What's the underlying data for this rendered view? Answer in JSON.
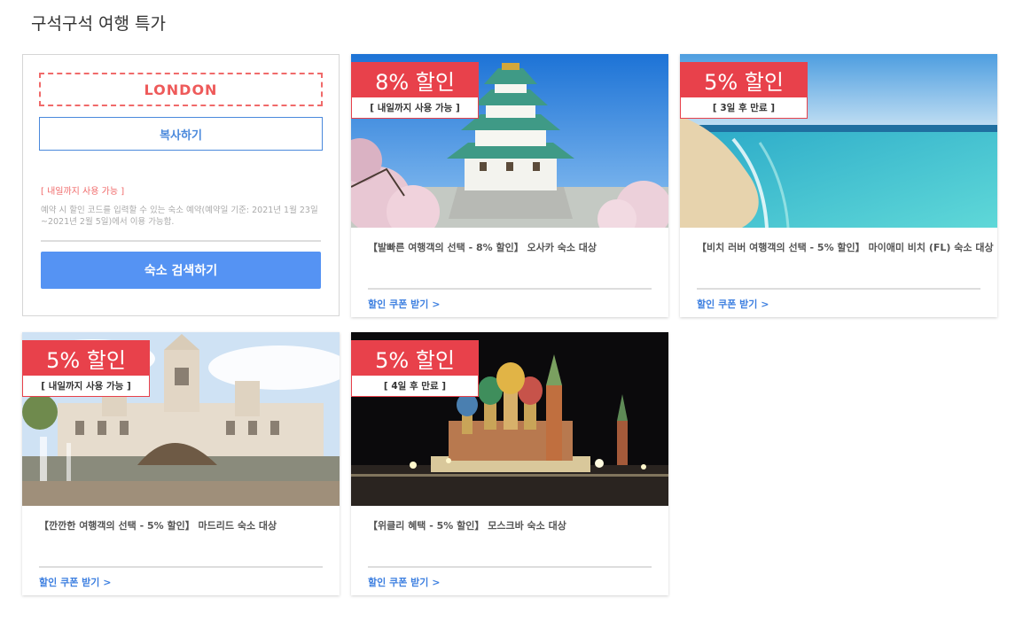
{
  "page": {
    "title": "구석구석 여행 특가"
  },
  "coupon": {
    "code": "LONDON",
    "copy_label": "복사하기",
    "validity": "[ 내일까지 사용 가능 ]",
    "description": "예약 시 할인 코드를 입력할 수 있는 숙소 예약(예약일 기준: 2021년 1월 23일~2021년 2월 5일)에서 이용 가능함.",
    "search_label": "숙소 검색하기"
  },
  "deals": [
    {
      "discount": "8% 할인",
      "validity": "[ 내일까지 사용 가능 ]",
      "title": "【발빠른 여행객의 선택 - 8% 할인】 오사카 숙소 대상",
      "link": "할인 쿠폰 받기 >"
    },
    {
      "discount": "5% 할인",
      "validity": "[ 3일 후 만료 ]",
      "title": "【비치 러버 여행객의 선택 - 5% 할인】 마이애미 비치 (FL) 숙소 대상",
      "link": "할인 쿠폰 받기 >"
    },
    {
      "discount": "5% 할인",
      "validity": "[ 내일까지 사용 가능 ]",
      "title": "【깐깐한 여행객의 선택 - 5% 할인】 마드리드 숙소 대상",
      "link": "할인 쿠폰 받기 >"
    },
    {
      "discount": "5% 할인",
      "validity": "[ 4일 후 만료 ]",
      "title": "【위클리 혜택 - 5% 할인】 모스크바 숙소 대상",
      "link": "할인 쿠폰 받기 >"
    }
  ],
  "colors": {
    "badge_red": "#e8414b",
    "coupon_red": "#ee5a5a",
    "link_blue": "#3d7fe0",
    "button_blue": "#5593f3"
  }
}
